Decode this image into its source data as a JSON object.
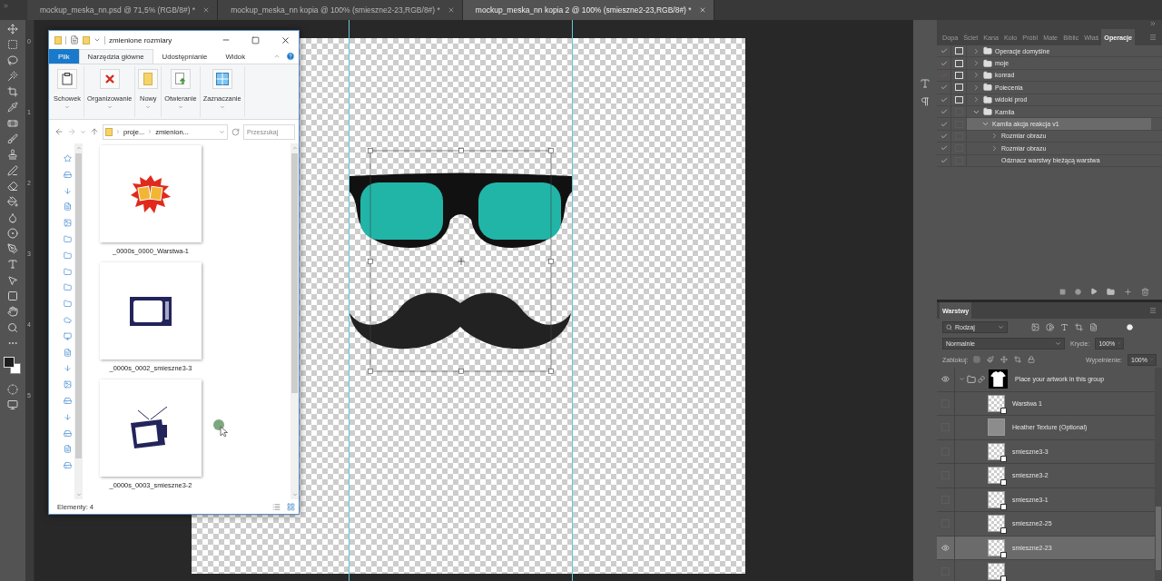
{
  "doc_tabs": [
    {
      "label": "mockup_meska_nn.psd @ 71,5% (RGB/8#) *",
      "selected": false
    },
    {
      "label": "mockup_meska_nn kopia @ 100% (smieszne2-23,RGB/8#) *",
      "selected": false
    },
    {
      "label": "mockup_meska_nn kopia 2 @ 100% (smieszne2-23,RGB/8#) *",
      "selected": true
    }
  ],
  "ruler_labels": [
    "0",
    "1",
    "2",
    "3",
    "4",
    "5"
  ],
  "explorer": {
    "title": "zmienione rozmiary",
    "ribbon_tabs": [
      {
        "label": "Plik",
        "kind": "file",
        "selected": false
      },
      {
        "label": "Narzędzia główne",
        "kind": "tab",
        "selected": true
      },
      {
        "label": "Udostępnianie",
        "kind": "tab",
        "selected": false
      },
      {
        "label": "Widok",
        "kind": "tab",
        "selected": false
      }
    ],
    "ribbon_groups": [
      {
        "label": "Schowek",
        "kind": "clipboard"
      },
      {
        "label": "Organizowanie",
        "kind": "organize"
      },
      {
        "label": "Nowy",
        "kind": "new"
      },
      {
        "label": "Otwieranie",
        "kind": "open"
      },
      {
        "label": "Zaznaczanie",
        "kind": "select"
      }
    ],
    "breadcrumbs": [
      "proje...",
      "zmienion..."
    ],
    "search": {
      "placeholder": "Przeszukaj"
    },
    "files": [
      {
        "name": "_0000s_0000_Warstwa-1",
        "kind": "beer"
      },
      {
        "name": "_0000s_0002_smieszne3-3",
        "kind": "tv"
      },
      {
        "name": "_0000s_0003_smieszne3-2",
        "kind": "tv-antenna"
      }
    ],
    "status": "Elementy: 4"
  },
  "actions": {
    "tabs": [
      {
        "label": "Dopa",
        "selected": false
      },
      {
        "label": "Ściet",
        "selected": false
      },
      {
        "label": "Kana",
        "selected": false
      },
      {
        "label": "Kolo",
        "selected": false
      },
      {
        "label": "Próbl",
        "selected": false
      },
      {
        "label": "Mate",
        "selected": false
      },
      {
        "label": "Biblic",
        "selected": false
      },
      {
        "label": "Właś",
        "selected": false
      },
      {
        "label": "Operacje",
        "selected": true
      }
    ],
    "items": [
      {
        "label": "Operacje domyślne",
        "kind": "set",
        "enabled": true,
        "partial": false,
        "dialog": true,
        "expanded": false,
        "selected": false
      },
      {
        "label": "moje",
        "kind": "set",
        "enabled": true,
        "partial": false,
        "dialog": true,
        "expanded": false,
        "selected": false
      },
      {
        "label": "konrad",
        "kind": "set",
        "enabled": true,
        "partial": true,
        "dialog": true,
        "expanded": false,
        "selected": false
      },
      {
        "label": "Polecenia",
        "kind": "set",
        "enabled": true,
        "partial": false,
        "dialog": true,
        "expanded": false,
        "selected": false
      },
      {
        "label": "widoki prod",
        "kind": "set",
        "enabled": true,
        "partial": false,
        "dialog": true,
        "expanded": false,
        "selected": false
      },
      {
        "label": "Kamila",
        "kind": "set",
        "enabled": true,
        "partial": false,
        "dialog": false,
        "expanded": true,
        "selected": false,
        "children": [
          {
            "label": "Kamila akcja reakcja v1",
            "kind": "step",
            "enabled": true,
            "partial": false,
            "dialog": false,
            "expanded": true,
            "selected": true,
            "children": [
              {
                "label": "Rozmiar obrazu",
                "kind": "step",
                "enabled": true,
                "partial": false,
                "dialog": false,
                "expanded": false,
                "selected": false
              },
              {
                "label": "Rozmiar obrazu",
                "kind": "step",
                "enabled": true,
                "partial": false,
                "dialog": false,
                "expanded": false,
                "selected": false
              },
              {
                "label": "Odznacz warstwy bieżącą warstwa",
                "kind": "leaf",
                "enabled": true,
                "partial": false,
                "dialog": false,
                "selected": false
              }
            ]
          }
        ]
      }
    ]
  },
  "layers": {
    "title": "Warstwy",
    "filter": "Rodzaj",
    "blend": "Normalnie",
    "opacity_label": "Krycie:",
    "opacity": "100%",
    "lock_label": "Zablokuj:",
    "fill_label": "Wypełnienie:",
    "fill": "100%",
    "items": [
      {
        "name": "Place your artwork in this group",
        "kind": "group",
        "visible": true,
        "expanded": true,
        "selected": false,
        "children": [
          {
            "name": "Warstwa 1",
            "kind": "smart",
            "visible": false,
            "selected": false
          },
          {
            "name": "Heather Texture (Optional)",
            "kind": "texture",
            "visible": false,
            "selected": false
          },
          {
            "name": "smieszne3-3",
            "kind": "smart",
            "visible": false,
            "selected": false
          },
          {
            "name": "smieszne3-2",
            "kind": "smart",
            "visible": false,
            "selected": false
          },
          {
            "name": "smieszne3-1",
            "kind": "smart",
            "visible": false,
            "selected": false
          },
          {
            "name": "smieszne2-25",
            "kind": "smart",
            "visible": false,
            "selected": false
          },
          {
            "name": "smieszne2-23",
            "kind": "smart",
            "visible": true,
            "selected": true
          },
          {
            "kind": "smart",
            "visible": false,
            "selected": false
          }
        ]
      }
    ]
  }
}
